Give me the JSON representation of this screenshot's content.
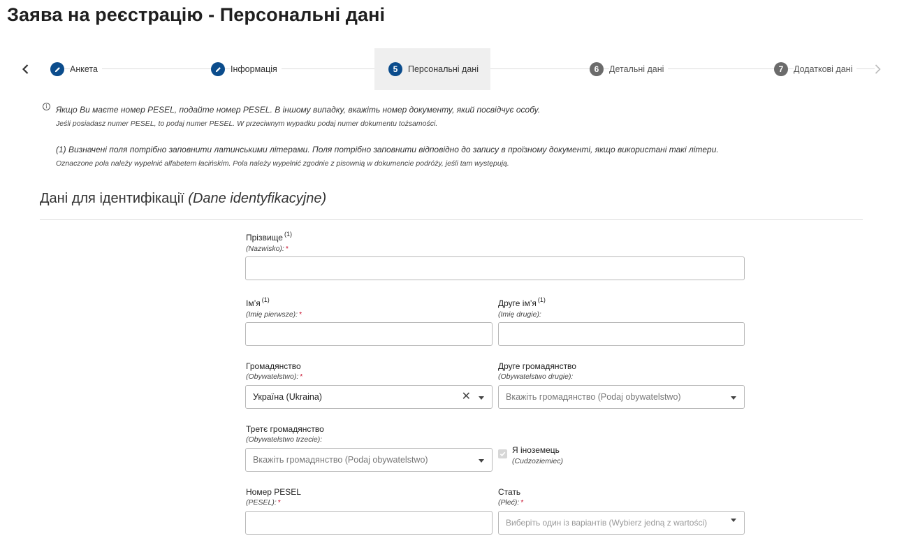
{
  "page": {
    "title": "Заява на реєстрацію - Персональні дані"
  },
  "stepper": {
    "steps": [
      {
        "number": "",
        "label": "Анкета",
        "state": "done"
      },
      {
        "number": "",
        "label": "Інформація",
        "state": "done"
      },
      {
        "number": "5",
        "label": "Персональні дані",
        "state": "current"
      },
      {
        "number": "6",
        "label": "Детальні дані",
        "state": "future"
      },
      {
        "number": "7",
        "label": "Додаткові дані",
        "state": "future"
      }
    ]
  },
  "notes": {
    "info_icon": "i",
    "pesel_ua": "Якщо Ви маєте номер PESEL, подайте номер PESEL. В іншому випадку, вкажіть номер документу, який посвідчує особу.",
    "pesel_pl": "Jeśli posiadasz numer PESEL, to podaj numer PESEL. W przeciwnym wypadku podaj numer dokumentu tożsamości.",
    "latin_ua": "(1) Визначені поля потрібно заповнити латинськими літерами. Поля потрібно заповнити відповідно до запису в проїзному документі, якщо використані такі літери.",
    "latin_pl": "Oznaczone pola należy wypełnić alfabetem łacińskim. Pola należy wypełnić zgodnie z pisownią w dokumencie podróży, jeśli tam występują."
  },
  "section": {
    "title": "Дані для ідентифікації",
    "title_pl": "(Dane identyfikacyjne)"
  },
  "form": {
    "surname": {
      "label": "Прізвище",
      "sup": "(1)",
      "sub": "(Nazwisko):",
      "req": "*",
      "value": ""
    },
    "first_name": {
      "label": "Ім’я",
      "sup": "(1)",
      "sub": "(Imię pierwsze):",
      "req": "*",
      "value": ""
    },
    "second_name": {
      "label": "Друге ім’я",
      "sup": "(1)",
      "sub": "(Imię drugie):",
      "value": ""
    },
    "citizenship": {
      "label": "Громадянство",
      "sub": "(Obywatelstwo):",
      "req": "*",
      "value": "Україна (Ukraina)",
      "clear": "✕"
    },
    "second_citizenship": {
      "label": "Друге громадянство",
      "sub": "(Obywatelstwo drugie):",
      "placeholder": "Вкажіть громадянство (Podaj obywatelstwo)"
    },
    "third_citizenship": {
      "label": "Третє громадянство",
      "sub": "(Obywatelstwo trzecie):",
      "placeholder": "Вкажіть громадянство (Podaj obywatelstwo)"
    },
    "foreigner": {
      "label": "Я іноземець",
      "sub": "(Cudzoziemiec)",
      "checked": true
    },
    "pesel": {
      "label": "Номер PESEL",
      "sub": "(PESEL):",
      "req": "*",
      "value": ""
    },
    "sex": {
      "label": "Стать",
      "sub": "(Płeć):",
      "req": "*",
      "placeholder": "Виберіть один із варіантів (Wybierz jedną z wartości)"
    }
  },
  "icons": {
    "back": "chevron-left-icon",
    "forward": "chevron-right-icon",
    "done_step": "pencil-icon",
    "info": "info-icon",
    "dropdown": "caret-down-icon",
    "clear": "close-icon",
    "checkbox": "check-icon"
  }
}
